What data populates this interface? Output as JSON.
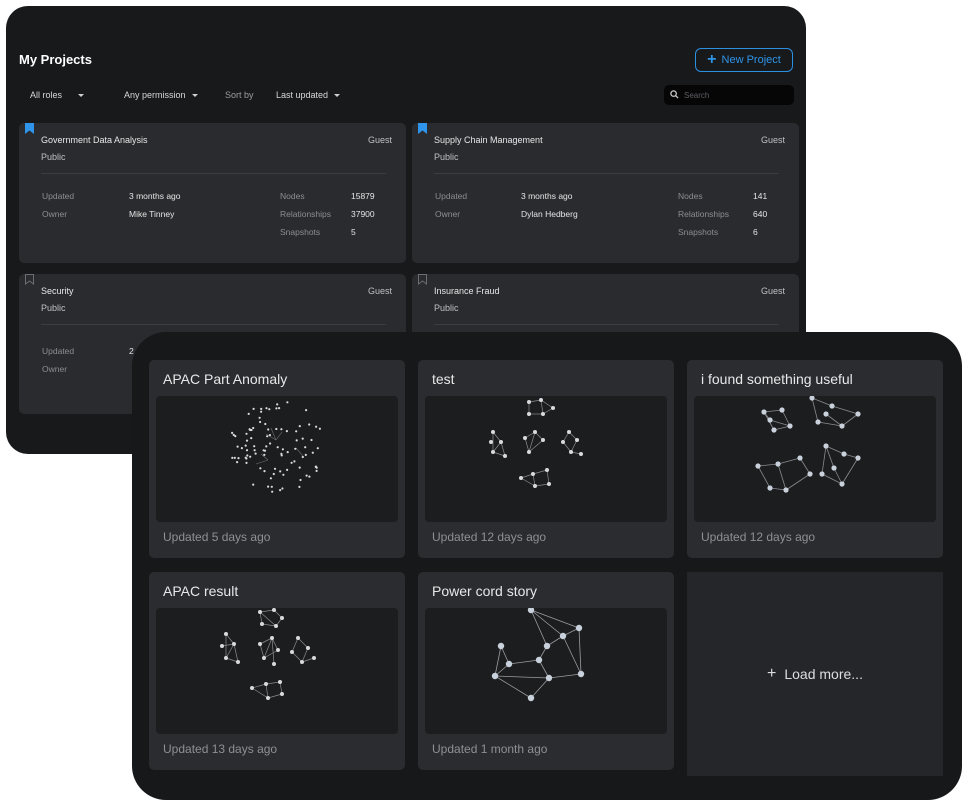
{
  "projects": {
    "title": "My Projects",
    "new_project_label": "New Project",
    "filters": {
      "roles": "All roles",
      "permission": "Any permission",
      "sort_by_label": "Sort by",
      "sort_value": "Last updated"
    },
    "search_placeholder": "Search",
    "labels": {
      "updated": "Updated",
      "owner": "Owner",
      "nodes": "Nodes",
      "relationships": "Relationships",
      "snapshots": "Snapshots"
    },
    "cards": [
      {
        "name": "Government Data Analysis",
        "visibility": "Public",
        "role": "Guest",
        "updated": "3 months ago",
        "owner": "Mike Tinney",
        "nodes": "15879",
        "relationships": "37900",
        "snapshots": "5",
        "bookmarked": true
      },
      {
        "name": "Supply Chain Management",
        "visibility": "Public",
        "role": "Guest",
        "updated": "3 months ago",
        "owner": "Dylan Hedberg",
        "nodes": "141",
        "relationships": "640",
        "snapshots": "6",
        "bookmarked": true
      },
      {
        "name": "Security",
        "visibility": "Public",
        "role": "Guest",
        "updated": "2",
        "owner": "",
        "bookmarked": false
      },
      {
        "name": "Insurance Fraud",
        "visibility": "Public",
        "role": "Guest",
        "bookmarked": false
      }
    ]
  },
  "graphs": {
    "cards": [
      {
        "title": "APAC Part Anomaly",
        "updated": "Updated 5 days ago"
      },
      {
        "title": "test",
        "updated": "Updated 12 days ago"
      },
      {
        "title": "i found something useful",
        "updated": "Updated 12 days ago"
      },
      {
        "title": "APAC result",
        "updated": "Updated 13 days ago"
      },
      {
        "title": "Power cord story",
        "updated": "Updated 1 month ago"
      }
    ],
    "load_more_label": "Load more..."
  },
  "colors": {
    "accent": "#2e95ea",
    "bookmark_active": "#2e95ea",
    "bookmark_inactive": "#6b6d71"
  }
}
